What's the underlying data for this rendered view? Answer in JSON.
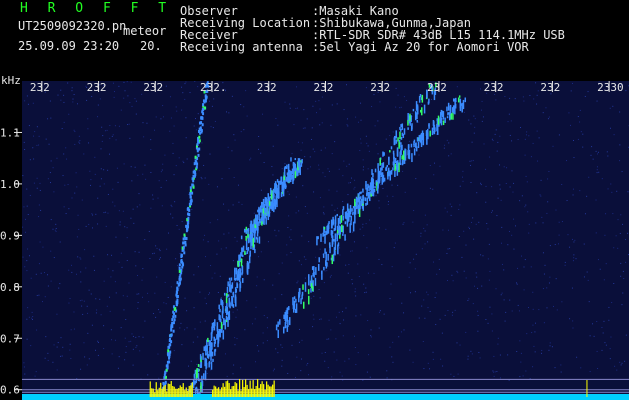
{
  "header": {
    "program": "H R O F F T",
    "file_name": "UT2509092320.pn",
    "detection_label": "meteor",
    "timestamp": "25.09.09 23:20",
    "interval": "20.",
    "fields": [
      {
        "label": "Observer",
        "value": ":Masaki Kano"
      },
      {
        "label": "Receiving Location",
        "value": ":Shibukawa,Gunma,Japan"
      },
      {
        "label": "Receiver",
        "value": ":RTL-SDR SDR# 43dB L15 114.1MHz USB"
      },
      {
        "label": "Receiving antenna",
        "value": ":5el Yagi Az 20 for Aomori VOR"
      }
    ]
  },
  "chart_data": {
    "type": "heatmap",
    "title": "",
    "ylabel": "kHz",
    "ylim": [
      0.58,
      1.2
    ],
    "y_ticks": [
      "1.1",
      "1.0",
      "0.9",
      "0.8",
      "0.7",
      "0.6"
    ],
    "y_tick_values": [
      1.1,
      1.0,
      0.9,
      0.8,
      0.7,
      0.6
    ],
    "x_ticks": [
      "232",
      "232",
      "232",
      "232.",
      "232",
      "232",
      "232",
      "232",
      "232",
      "232",
      "2330"
    ],
    "x_minutes": [
      20,
      21,
      22,
      23,
      24,
      25,
      26,
      27,
      28,
      29,
      30
    ],
    "background_color": "#0a0f3a",
    "signal_color": "#3b8cff",
    "strong_signal_color": "#33ff66",
    "noise_color": "#ffff00",
    "baseline_color": "#00cfff",
    "reference_line_color": "#8888cc",
    "reference_lines_khz": [
      0.6,
      0.62
    ],
    "echo_traces": [
      {
        "name": "",
        "t_start_min": 22.1,
        "t_end_min": 22.9,
        "f_start_khz": 0.58,
        "f_end_khz": 1.2
      },
      {
        "name": "",
        "t_start_min": 22.6,
        "t_end_min": 23.7,
        "f_start_khz": 0.58,
        "f_end_khz": 0.9
      },
      {
        "name": "",
        "t_start_min": 23.6,
        "t_end_min": 24.5,
        "f_start_khz": 0.9,
        "f_end_khz": 1.05
      },
      {
        "name": "",
        "t_start_min": 24.2,
        "t_end_min": 26.9,
        "f_start_khz": 0.72,
        "f_end_khz": 1.2
      },
      {
        "name": "",
        "t_start_min": 24.9,
        "t_end_min": 27.4,
        "f_start_khz": 0.9,
        "f_end_khz": 1.17
      }
    ]
  }
}
